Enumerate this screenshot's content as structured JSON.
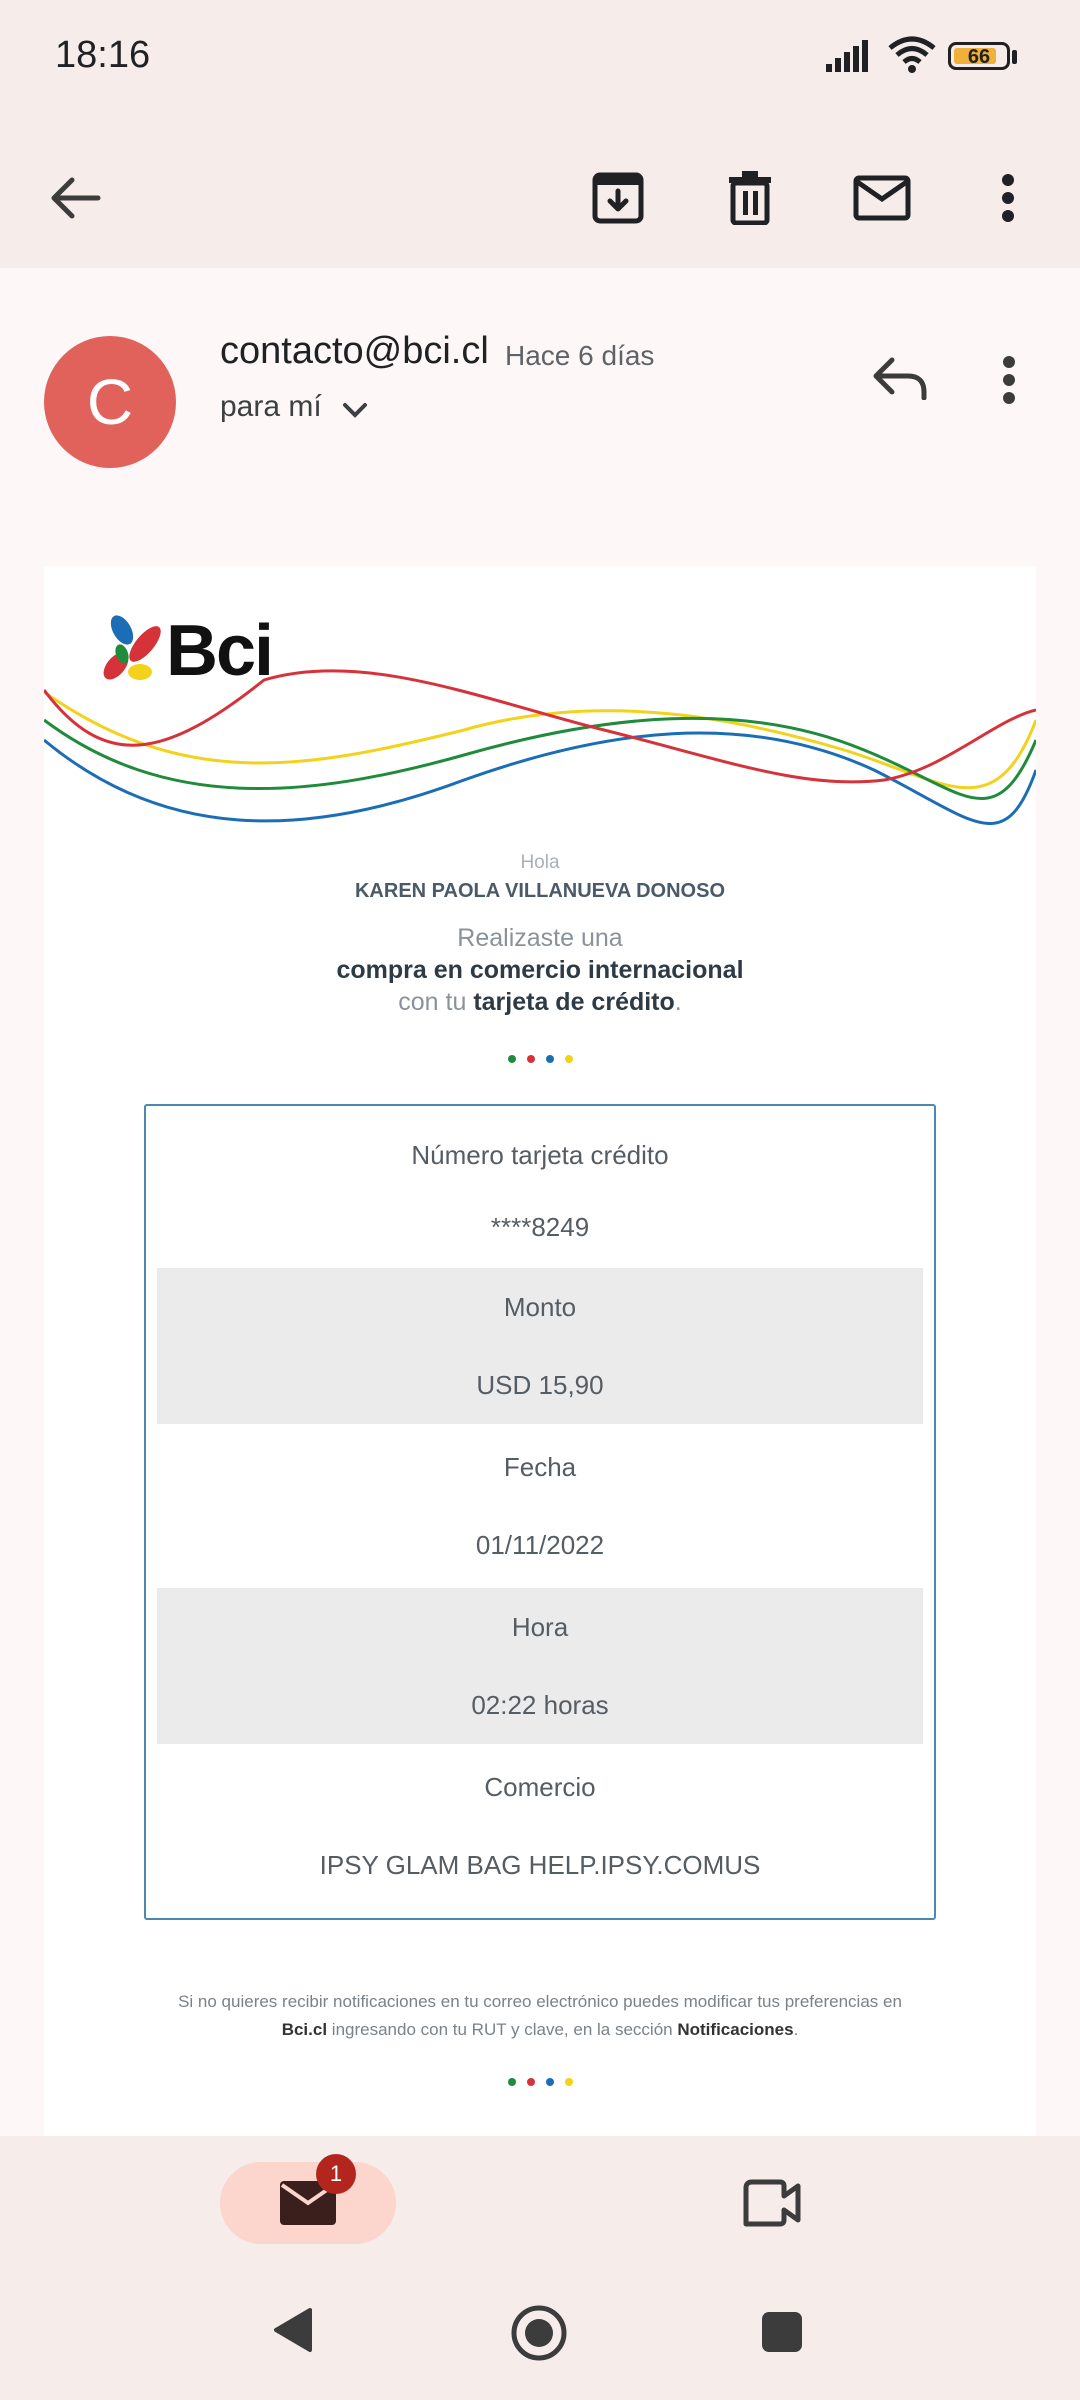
{
  "status_bar": {
    "time": "18:16",
    "battery": "66"
  },
  "app_bar": {
    "icons": [
      "back-arrow-icon",
      "archive-icon",
      "delete-icon",
      "mark-unread-icon",
      "more-vert-icon"
    ]
  },
  "email": {
    "avatar_letter": "C",
    "sender": "contacto@bci.cl",
    "time_ago": "Hace 6 días",
    "recipient": "para mí",
    "body": {
      "logo_text": "Bci",
      "greeting": "Hola",
      "name": "KAREN PAOLA VILLANUEVA DONOSO",
      "message_line1": "Realizaste una",
      "message_line2": "compra en comercio internacional",
      "message_line3_prefix": "con tu",
      "message_line3_bold": "tarjeta de crédito",
      "message_line3_suffix": ".",
      "details": [
        {
          "label": "Número tarjeta crédito",
          "value": "****8249"
        },
        {
          "label": "Monto",
          "value": "USD 15,90"
        },
        {
          "label": "Fecha",
          "value": "01/11/2022"
        },
        {
          "label": "Hora",
          "value": "02:22 horas"
        },
        {
          "label": "Comercio",
          "value": "IPSY GLAM BAG HELP.IPSY.COMUS"
        }
      ],
      "footer_line1": "Si no quieres recibir notificaciones en tu correo electrónico puedes modificar tus preferencias en",
      "footer_link": "Bci.cl",
      "footer_mid": "ingresando con tu RUT y clave, en la sección",
      "footer_bold": "Notificaciones",
      "footer_end": ".",
      "brand_colors": [
        "#1f8b3b",
        "#d6323a",
        "#1b6db5",
        "#f2d21b"
      ]
    }
  },
  "bottom_nav": {
    "mail_badge": "1"
  }
}
